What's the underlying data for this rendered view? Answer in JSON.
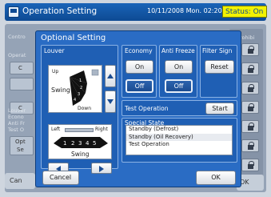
{
  "titlebar": {
    "title": "Operation Setting",
    "datetime": "10/11/2008 Mon. 02:20 PM",
    "status": "Status: On"
  },
  "background": {
    "labels": [
      "Contro",
      "Operat",
      "Louver",
      "Econo",
      "Anti Fr",
      "Test O"
    ],
    "right_col_label": "rohibi",
    "opt_label": "Opt",
    "se_label": "Se",
    "cancel": "Can",
    "ok_partial": "OK",
    "c1": "C",
    "c2": "C"
  },
  "dialog": {
    "title": "Optional Setting",
    "louver": {
      "label": "Louver",
      "up": "Up",
      "down": "Down",
      "swing": "Swing",
      "positions": [
        "1",
        "2",
        "3",
        "4"
      ]
    },
    "lr": {
      "left": "Left",
      "right": "Right",
      "swing": "Swing",
      "positions": [
        "1",
        "2",
        "3",
        "4",
        "5"
      ]
    },
    "economy": {
      "label": "Economy",
      "on": "On",
      "off": "Off"
    },
    "anti_freeze": {
      "label": "Anti Freeze",
      "on": "On",
      "off": "Off"
    },
    "filter_sign": {
      "label": "Filter Sign",
      "reset": "Reset"
    },
    "test_operation": {
      "label": "Test Operation",
      "start": "Start"
    },
    "special_state": {
      "label": "Special State",
      "items": [
        "Standby (Defrost)",
        "Standby (Oil Recovery)",
        "Test Operation"
      ]
    },
    "cancel": "Cancel",
    "ok": "OK"
  }
}
